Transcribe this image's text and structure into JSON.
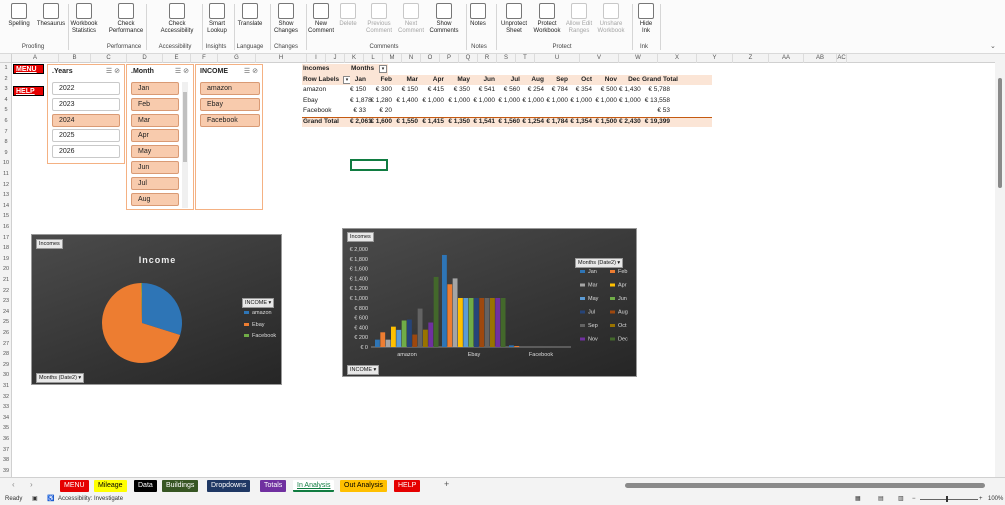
{
  "ribbon": {
    "buttons": [
      "Spelling",
      "Thesaurus",
      "Workbook Statistics",
      "Check Performance",
      "Check Accessibility",
      "Smart Lookup",
      "Translate",
      "Show Changes",
      "New Comment",
      "Delete",
      "Previous Comment",
      "Next Comment",
      "Show Comments",
      "Notes",
      "Unprotect Sheet",
      "Protect Workbook",
      "Allow Edit Ranges",
      "Unshare Workbook",
      "Hide Ink"
    ],
    "groups": [
      "Proofing",
      "Performance",
      "Accessibility",
      "Insights",
      "Language",
      "Changes",
      "Comments",
      "Notes",
      "Protect",
      "Ink"
    ]
  },
  "columns": [
    "A",
    "B",
    "C",
    "D",
    "E",
    "F",
    "G",
    "H",
    "I",
    "J",
    "K",
    "L",
    "M",
    "N",
    "O",
    "P",
    "Q",
    "R",
    "S",
    "T",
    "U",
    "V",
    "W",
    "X",
    "Y",
    "Z",
    "AA",
    "AB",
    "AC"
  ],
  "rows": [
    "1",
    "2",
    "3",
    "4",
    "5",
    "6",
    "7",
    "8",
    "9",
    "10",
    "11",
    "12",
    "13",
    "14",
    "15",
    "16",
    "17",
    "18",
    "19",
    "20",
    "21",
    "22",
    "23",
    "24",
    "25",
    "26",
    "27",
    "28",
    "29",
    "30",
    "31",
    "32",
    "33",
    "34",
    "35",
    "36",
    "37",
    "38",
    "39"
  ],
  "buttons": {
    "menu": "MENU",
    "help": "HELP"
  },
  "slicers": {
    "years": {
      "title": ".Years",
      "items": [
        "2022",
        "2023",
        "2024",
        "2025",
        "2026"
      ]
    },
    "month": {
      "title": ".Month",
      "items": [
        "Jan",
        "Feb",
        "Mar",
        "Apr",
        "May",
        "Jun",
        "Jul",
        "Aug"
      ]
    },
    "income": {
      "title": "INCOME",
      "items": [
        "amazon",
        "Ebay",
        "Facebook"
      ]
    }
  },
  "pivot": {
    "title": "Incomes",
    "months_label": "Months",
    "row_labels": "Row Labels",
    "headers": [
      "Jan",
      "Feb",
      "Mar",
      "Apr",
      "May",
      "Jun",
      "Jul",
      "Aug",
      "Sep",
      "Oct",
      "Nov",
      "Dec",
      "Grand Total"
    ],
    "rows": [
      {
        "label": "amazon",
        "values": [
          "€ 150",
          "€ 300",
          "€ 150",
          "€ 415",
          "€ 350",
          "€ 541",
          "€ 560",
          "€ 254",
          "€ 784",
          "€ 354",
          "€ 500",
          "€ 1,430",
          "€ 5,788"
        ]
      },
      {
        "label": "Ebay",
        "values": [
          "€ 1,878",
          "€ 1,280",
          "€ 1,400",
          "€ 1,000",
          "€ 1,000",
          "€ 1,000",
          "€ 1,000",
          "€ 1,000",
          "€ 1,000",
          "€ 1,000",
          "€ 1,000",
          "€ 1,000",
          "€ 13,558"
        ]
      },
      {
        "label": "Facebook",
        "values": [
          "€ 33",
          "€ 20",
          "",
          "",
          "",
          "",
          "",
          "",
          "",
          "",
          "",
          "",
          "€ 53"
        ]
      },
      {
        "label": "Grand Total",
        "values": [
          "€ 2,061",
          "€ 1,600",
          "€ 1,550",
          "€ 1,415",
          "€ 1,350",
          "€ 1,541",
          "€ 1,560",
          "€ 1,254",
          "€ 1,784",
          "€ 1,354",
          "€ 1,500",
          "€ 2,430",
          "€ 19,399"
        ]
      }
    ]
  },
  "pie": {
    "tag": "Incomes",
    "title": "Income",
    "filter": "INCOME",
    "axis": "Months (Date2)",
    "legend": [
      "amazon",
      "Ebay",
      "Facebook"
    ]
  },
  "chart_data": [
    {
      "type": "pie",
      "title": "Income",
      "categories": [
        "amazon",
        "Ebay",
        "Facebook"
      ],
      "values": [
        5788,
        13558,
        53
      ],
      "colors": [
        "#2e75b6",
        "#ed7d31",
        "#70ad47"
      ]
    },
    {
      "type": "bar",
      "categories": [
        "amazon",
        "Ebay",
        "Facebook"
      ],
      "ylim": [
        0,
        2000
      ],
      "yticks": [
        "€ 2,000",
        "€ 1,800",
        "€ 1,600",
        "€ 1,400",
        "€ 1,200",
        "€ 1,000",
        "€ 800",
        "€ 600",
        "€ 400",
        "€ 200",
        "€ 0"
      ],
      "series": [
        {
          "name": "Jan",
          "values": [
            150,
            1878,
            33
          ],
          "color": "#2e75b6"
        },
        {
          "name": "Feb",
          "values": [
            300,
            1280,
            20
          ],
          "color": "#ed7d31"
        },
        {
          "name": "Mar",
          "values": [
            150,
            1400,
            0
          ],
          "color": "#a5a5a5"
        },
        {
          "name": "Apr",
          "values": [
            415,
            1000,
            0
          ],
          "color": "#ffc000"
        },
        {
          "name": "May",
          "values": [
            350,
            1000,
            0
          ],
          "color": "#5b9bd5"
        },
        {
          "name": "Jun",
          "values": [
            541,
            1000,
            0
          ],
          "color": "#70ad47"
        },
        {
          "name": "Jul",
          "values": [
            560,
            1000,
            0
          ],
          "color": "#264478"
        },
        {
          "name": "Aug",
          "values": [
            254,
            1000,
            0
          ],
          "color": "#9e480e"
        },
        {
          "name": "Sep",
          "values": [
            784,
            1000,
            0
          ],
          "color": "#636363"
        },
        {
          "name": "Oct",
          "values": [
            354,
            1000,
            0
          ],
          "color": "#997300"
        },
        {
          "name": "Nov",
          "values": [
            500,
            1000,
            0
          ],
          "color": "#7030a0"
        },
        {
          "name": "Dec",
          "values": [
            1430,
            1000,
            0
          ],
          "color": "#43682b"
        }
      ]
    }
  ],
  "bar": {
    "tag": "Incomes",
    "filter": "Months (Date2)",
    "axis": "INCOME"
  },
  "tabs": [
    {
      "label": "MENU",
      "bg": "#e50000",
      "fg": "#ffffff"
    },
    {
      "label": "Mileage",
      "bg": "#ffff00",
      "fg": "#000000"
    },
    {
      "label": "Data",
      "bg": "#000000",
      "fg": "#ffffff"
    },
    {
      "label": "Buildings",
      "bg": "#375623",
      "fg": "#ffffff"
    },
    {
      "label": "Dropdowns",
      "bg": "#1f3864",
      "fg": "#ffffff"
    },
    {
      "label": "Totals",
      "bg": "#7030a0",
      "fg": "#ffffff"
    },
    {
      "label": "In Analysis",
      "bg": "#ffffff",
      "fg": "#107c41"
    },
    {
      "label": "Out Analysis",
      "bg": "#ffc000",
      "fg": "#000000"
    },
    {
      "label": "HELP",
      "bg": "#e50000",
      "fg": "#ffffff"
    }
  ],
  "status": {
    "ready": "Ready",
    "accessibility": "Accessibility: Investigate",
    "zoom": "100%"
  }
}
